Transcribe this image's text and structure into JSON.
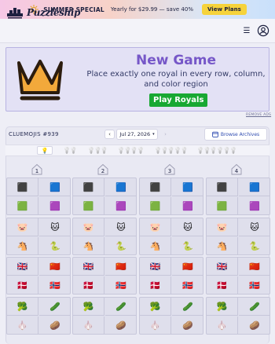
{
  "banner": {
    "title": "SUMMER SPECIAL",
    "text": "Yearly for $29.99 — save 40%",
    "button": "View Plans"
  },
  "header": {
    "logo_text": "Puzzleship"
  },
  "ad": {
    "title": "New Game",
    "description": "Place exactly one royal in every row, column, and color region",
    "button": "Play Royals",
    "remove_ads": "REMOVE ADS"
  },
  "puzzle": {
    "id": "CLUEMOJIS #939",
    "date": "Jul 27, 2026",
    "archive_button": "Browse Archives",
    "columns": [
      "1",
      "2",
      "3",
      "4"
    ]
  },
  "rows": [
    [
      "⬛",
      "🟦",
      "🟩",
      "🟪"
    ],
    [
      "🐷",
      "🐱",
      "🐴",
      "🐍"
    ],
    [
      "🇬🇧",
      "🇨🇳",
      "🇩🇰",
      "🇳🇴"
    ],
    [
      "🥦",
      "🥒",
      "🧄",
      "🥔"
    ]
  ],
  "colors": {
    "accent_purple": "#7657c8",
    "play_green": "#18a833",
    "plans_yellow": "#f6d33c"
  }
}
